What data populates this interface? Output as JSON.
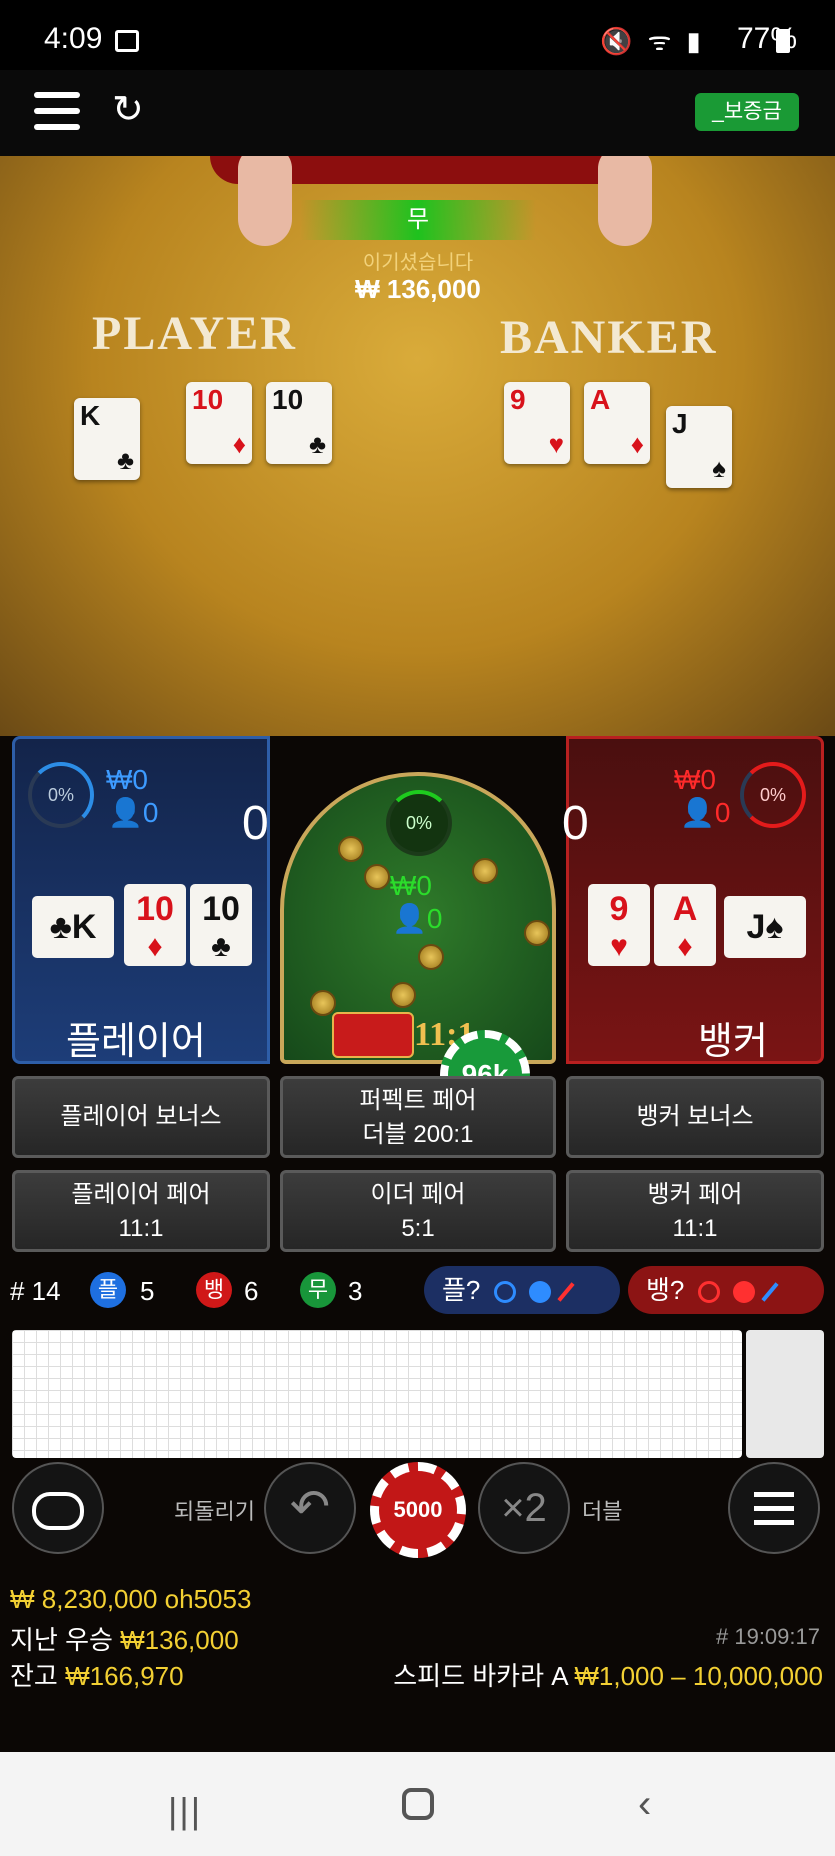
{
  "status_bar": {
    "time": "4:09",
    "battery": "77%"
  },
  "top_bar": {
    "deposit_label": "_보증금"
  },
  "table": {
    "result_banner": "무",
    "win_text": "이기셨습니다",
    "win_amount": "₩ 136,000",
    "player_title": "PLAYER",
    "banker_title": "BANKER",
    "player_cards": [
      {
        "rank": "K",
        "suit": "♣",
        "color": "black"
      },
      {
        "rank": "10",
        "suit": "♦",
        "color": "red"
      },
      {
        "rank": "10",
        "suit": "♣",
        "color": "black"
      }
    ],
    "banker_cards": [
      {
        "rank": "9",
        "suit": "♥",
        "color": "red"
      },
      {
        "rank": "A",
        "suit": "♦",
        "color": "red"
      },
      {
        "rank": "J",
        "suit": "♠",
        "color": "black"
      }
    ]
  },
  "bets": {
    "player": {
      "percent": "0%",
      "amount": "₩0",
      "count": "0",
      "score": "0",
      "label": "플레이어",
      "cards": [
        {
          "rank": "K",
          "suit": "♣"
        },
        {
          "rank": "10",
          "suit": "♦"
        },
        {
          "rank": "10",
          "suit": "♣"
        }
      ]
    },
    "tie": {
      "percent": "0%",
      "amount": "₩0",
      "count": "0",
      "odds": "11:1",
      "chip": "96k"
    },
    "banker": {
      "percent": "0%",
      "amount": "₩0",
      "count": "0",
      "score": "0",
      "label": "뱅커",
      "cards": [
        {
          "rank": "9",
          "suit": "♥"
        },
        {
          "rank": "A",
          "suit": "♦"
        },
        {
          "rank": "J",
          "suit": "♠"
        }
      ]
    },
    "side_bets": {
      "player_bonus": "플레이어 보너스",
      "perfect_pair": "퍼펙트 페어",
      "perfect_pair_odds": "더블 200:1",
      "banker_bonus": "뱅커 보너스",
      "player_pair": "플레이어 페어",
      "player_pair_odds": "11:1",
      "either_pair": "이더 페어",
      "either_pair_odds": "5:1",
      "banker_pair": "뱅커 페어",
      "banker_pair_odds": "11:1"
    }
  },
  "stats": {
    "round": "# 14",
    "player_icon": "플",
    "player_count": "5",
    "banker_icon": "뱅",
    "banker_count": "6",
    "tie_icon": "무",
    "tie_count": "3",
    "player_ask": "플?",
    "banker_ask": "뱅?"
  },
  "controls": {
    "undo_label": "되돌리기",
    "chip_value": "5000",
    "double_label": "더블",
    "double_icon": "×2"
  },
  "footer": {
    "balance_total": "₩ 8,230,000",
    "username": "oh5053",
    "last_win_label": "지난 우승",
    "last_win_amount": "₩136,000",
    "balance_label": "잔고",
    "balance_amount": "₩166,970",
    "game_id": "# 19:09:17",
    "table_name": "스피드 바카라 A",
    "limits": "₩1,000 – 10,000,000"
  },
  "colors": {
    "player_blue": "#1d3d78",
    "banker_red": "#7a1414",
    "tie_green": "#16491a",
    "accent_yellow": "#f3d033",
    "deposit_green": "#1a9a35"
  }
}
